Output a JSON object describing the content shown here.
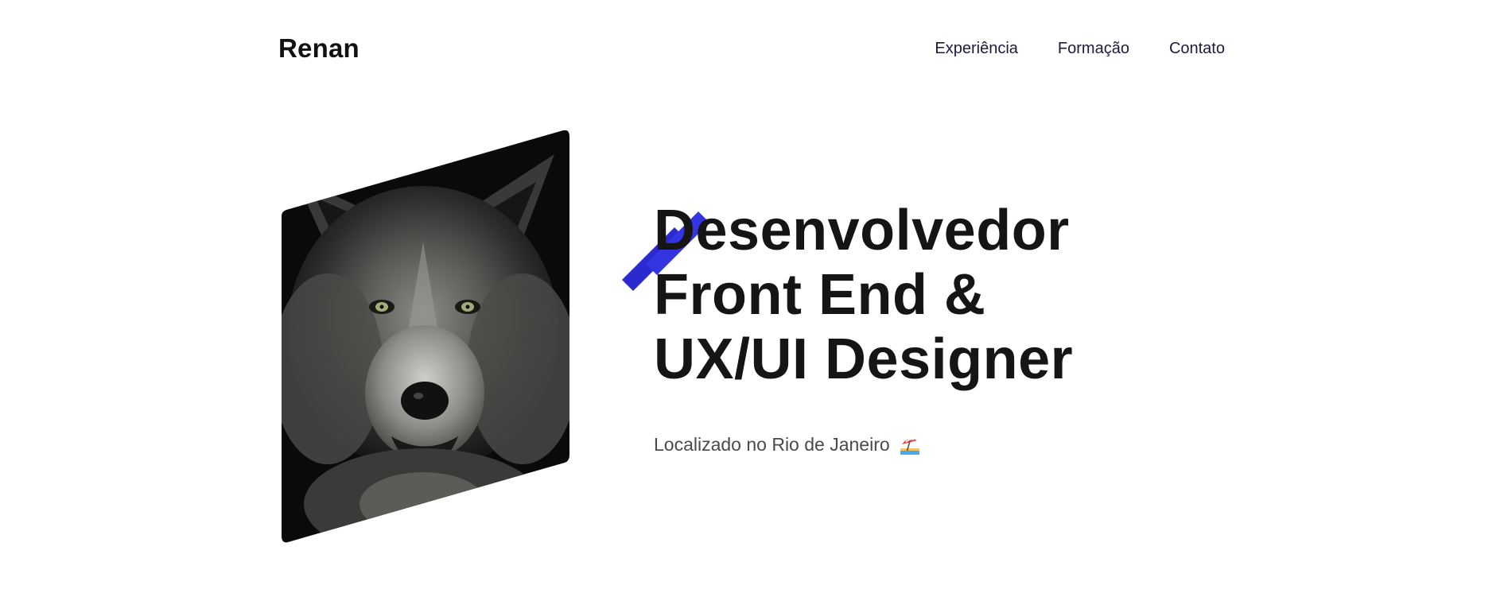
{
  "header": {
    "logo": "Renan",
    "nav": [
      {
        "label": "Experiência"
      },
      {
        "label": "Formação"
      },
      {
        "label": "Contato"
      }
    ]
  },
  "hero": {
    "photo_icon": "wolf-portrait-image",
    "accent_icon": "diagonal-stripes-icon",
    "headline": [
      "Desenvolvedor",
      "Front End &",
      "UX/UI Designer"
    ],
    "location": "Localizado no Rio de Janeiro",
    "location_icon": "beach-umbrella-icon"
  },
  "colors": {
    "accent": "#2f2fd8",
    "text": "#151515",
    "nav_text": "#1d1a3d"
  }
}
